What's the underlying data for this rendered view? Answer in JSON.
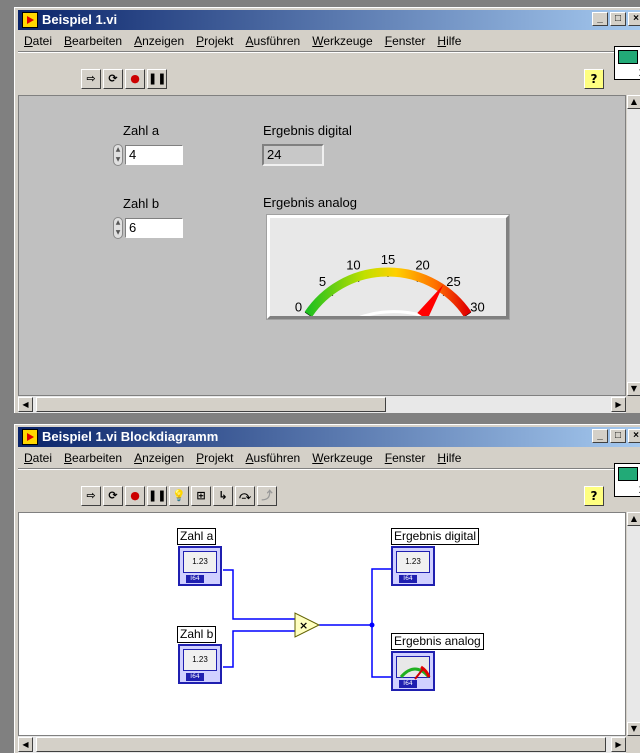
{
  "frontpanel": {
    "title": "Beispiel 1.vi",
    "menu": [
      "Datei",
      "Bearbeiten",
      "Anzeigen",
      "Projekt",
      "Ausführen",
      "Werkzeuge",
      "Fenster",
      "Hilfe"
    ],
    "help_label": "?",
    "controls": {
      "zahl_a": {
        "label": "Zahl a",
        "value": "4"
      },
      "zahl_b": {
        "label": "Zahl b",
        "value": "6"
      }
    },
    "indicators": {
      "digital": {
        "label": "Ergebnis digital",
        "value": "24"
      },
      "analog": {
        "label": "Ergebnis analog",
        "value": 24,
        "min": 0,
        "max": 30,
        "ticks": [
          "0",
          "5",
          "10",
          "15",
          "20",
          "25",
          "30"
        ],
        "needle_color": "#ff0000"
      }
    }
  },
  "blockdiagram": {
    "title": "Beispiel 1.vi Blockdiagramm",
    "menu": [
      "Datei",
      "Bearbeiten",
      "Anzeigen",
      "Projekt",
      "Ausführen",
      "Werkzeuge",
      "Fenster",
      "Hilfe"
    ],
    "help_label": "?",
    "terminals": {
      "zahl_a": {
        "label": "Zahl a",
        "display": "1.23",
        "type": "I64"
      },
      "zahl_b": {
        "label": "Zahl b",
        "display": "1.23",
        "type": "I64"
      },
      "digital": {
        "label": "Ergebnis digital",
        "display": "1.23",
        "type": "I64"
      },
      "analog": {
        "label": "Ergebnis analog",
        "type": "I64"
      }
    },
    "multiply_symbol": "×",
    "wire_color": "#0000ff"
  }
}
